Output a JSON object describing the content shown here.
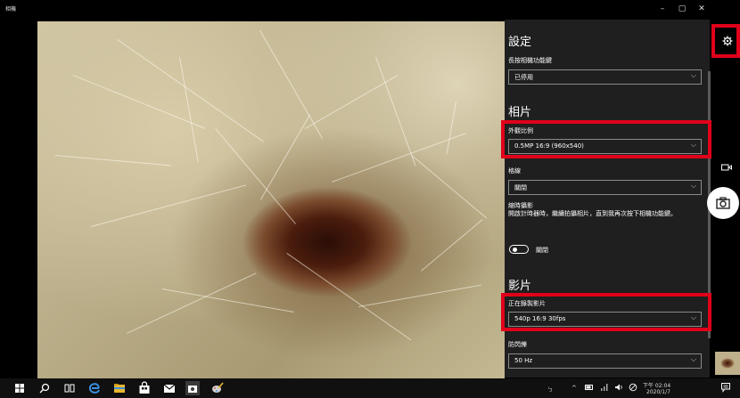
{
  "window": {
    "title": "相機",
    "minimize": "–",
    "maximize": "▢",
    "close": "✕"
  },
  "settings": {
    "title": "設定",
    "hold_label": "長按相機功能鍵",
    "hold_value": "已停用",
    "photos_title": "相片",
    "aspect_label": "外觀比例",
    "aspect_value": "0.5MP 16:9 (960x540)",
    "grid_label": "格線",
    "grid_value": "關閉",
    "timelapse_label": "縮時攝影",
    "timelapse_desc": "開啟計時器時，繼續拍攝相片，直到我再次按下相機功能鍵。",
    "timelapse_toggle_text": "關閉",
    "timelapse_on": false,
    "videos_title": "影片",
    "recording_label": "正在錄製影片",
    "recording_value": "540p 16:9 30fps",
    "flicker_label": "防閃爍",
    "flicker_value": "50 Hz"
  },
  "taskbar": {
    "time": "下午 02:04",
    "date": "2020/1/7",
    "lang": "ㄅ"
  },
  "colors": {
    "highlight": "#e0001a",
    "panel": "#1f1f1f"
  }
}
